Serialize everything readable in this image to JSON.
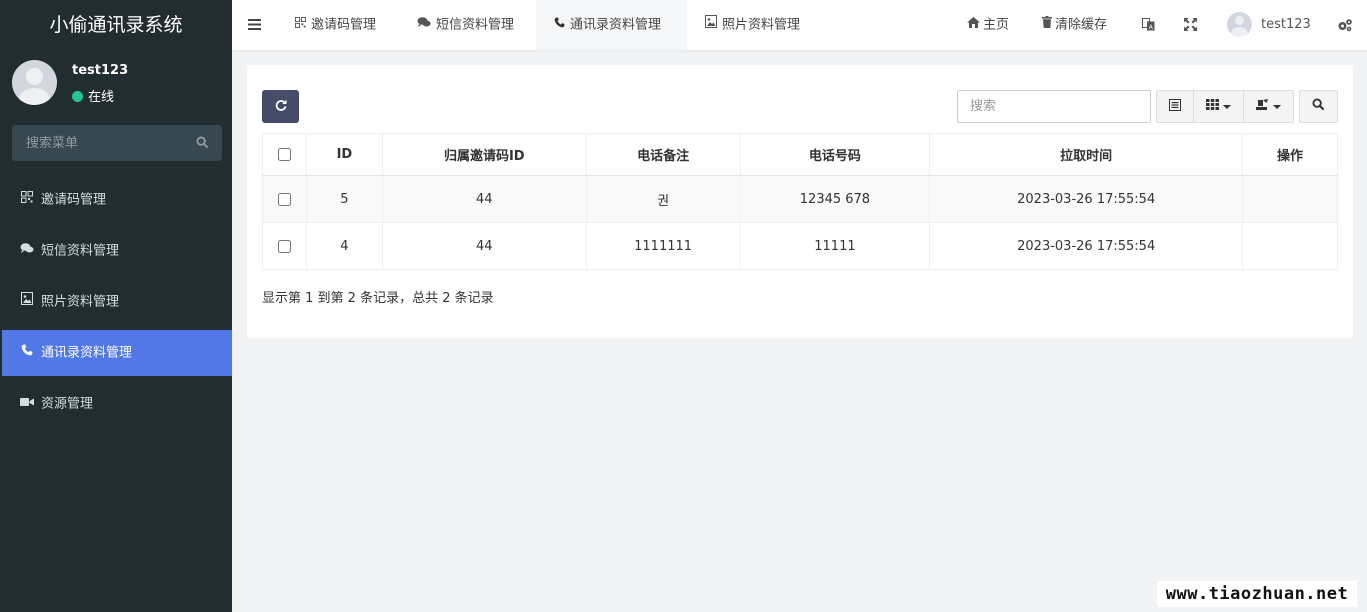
{
  "app": {
    "title": "小偷通讯录系统"
  },
  "user": {
    "name": "test123",
    "status": "在线"
  },
  "sidebar": {
    "search_placeholder": "搜索菜单",
    "items": [
      {
        "label": "邀请码管理",
        "icon": "qrcode-icon",
        "active": false
      },
      {
        "label": "短信资料管理",
        "icon": "comments-icon",
        "active": false
      },
      {
        "label": "照片资料管理",
        "icon": "image-icon",
        "active": false
      },
      {
        "label": "通讯录资料管理",
        "icon": "phone-icon",
        "active": true
      },
      {
        "label": "资源管理",
        "icon": "video-icon",
        "active": false
      }
    ]
  },
  "topnav": {
    "tabs": [
      {
        "label": "邀请码管理",
        "icon": "qrcode-icon"
      },
      {
        "label": "短信资料管理",
        "icon": "comments-icon"
      },
      {
        "label": "通讯录资料管理",
        "icon": "phone-icon",
        "active": true
      },
      {
        "label": "照片资料管理",
        "icon": "image-icon"
      }
    ],
    "home_label": "主页",
    "clear_cache_label": "清除缓存",
    "username": "test123"
  },
  "toolbar": {
    "search_placeholder": "搜索"
  },
  "table": {
    "columns": [
      "ID",
      "归属邀请码ID",
      "电话备注",
      "电话号码",
      "拉取时间",
      "操作"
    ],
    "rows": [
      {
        "id": "5",
        "invite_id": "44",
        "note": "권",
        "phone": "12345 678",
        "time": "2023-03-26 17:55:54",
        "action": ""
      },
      {
        "id": "4",
        "invite_id": "44",
        "note": "1111111",
        "phone": "11111",
        "time": "2023-03-26 17:55:54",
        "action": ""
      }
    ]
  },
  "pagination": {
    "summary": "显示第 1 到第 2 条记录，总共 2 条记录"
  },
  "watermark": "www.tiaozhuan.net",
  "colors": {
    "sidebar_bg": "#222d32",
    "active_item": "#5178e6",
    "refresh_button": "#444c69",
    "online_dot": "#22c39b"
  }
}
